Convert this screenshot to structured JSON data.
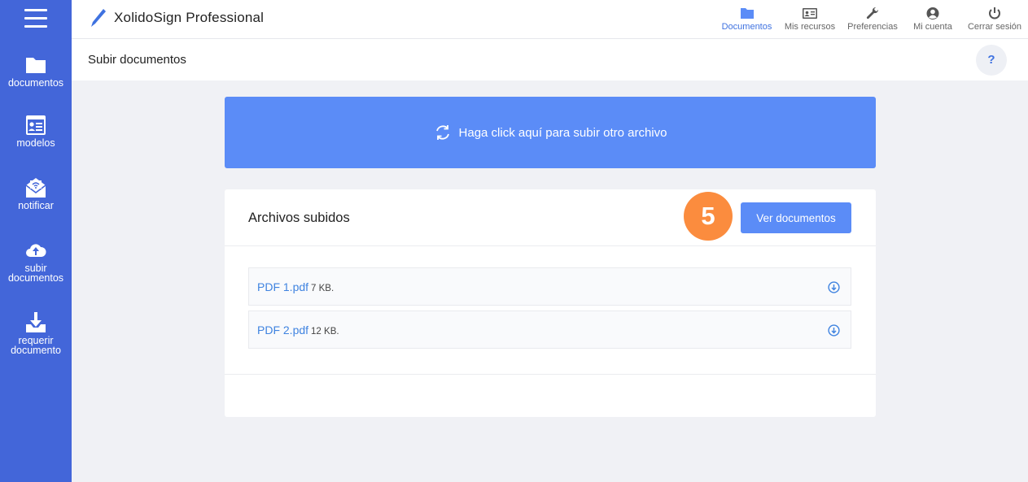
{
  "sidebar": {
    "menu_icon": "hamburger-icon",
    "items": [
      {
        "label": "documentos",
        "icon": "folder-icon"
      },
      {
        "label": "modelos",
        "icon": "template-icon"
      },
      {
        "label": "notificar",
        "icon": "notify-mail-icon"
      },
      {
        "label": "subir documentos",
        "icon": "cloud-upload-icon"
      },
      {
        "label": "requerir documento",
        "icon": "inbox-download-icon"
      }
    ]
  },
  "header": {
    "brand": "XolidoSign Professional",
    "brand_icon": "pen-icon",
    "nav": [
      {
        "label": "Documentos",
        "icon": "folder-icon",
        "active": true
      },
      {
        "label": "Mis recursos",
        "icon": "id-card-icon",
        "active": false
      },
      {
        "label": "Preferencias",
        "icon": "wrench-icon",
        "active": false
      },
      {
        "label": "Mi cuenta",
        "icon": "user-icon",
        "active": false
      },
      {
        "label": "Cerrar sesión",
        "icon": "power-icon",
        "active": false
      }
    ]
  },
  "subheader": {
    "title": "Subir documentos",
    "help_label": "?"
  },
  "upload": {
    "label": "Haga click aquí para subir otro archivo",
    "icon": "refresh-icon"
  },
  "uploaded": {
    "title": "Archivos subidos",
    "step_number": "5",
    "button_label": "Ver documentos",
    "files": [
      {
        "name": "PDF 1.pdf",
        "size": "7 KB."
      },
      {
        "name": "PDF 2.pdf",
        "size": "12 KB."
      }
    ]
  },
  "colors": {
    "sidebar": "#4366d9",
    "accent": "#5b8cf7",
    "link": "#3f83e0",
    "step_badge": "#fb8c3e",
    "background": "#f0f1f5"
  }
}
